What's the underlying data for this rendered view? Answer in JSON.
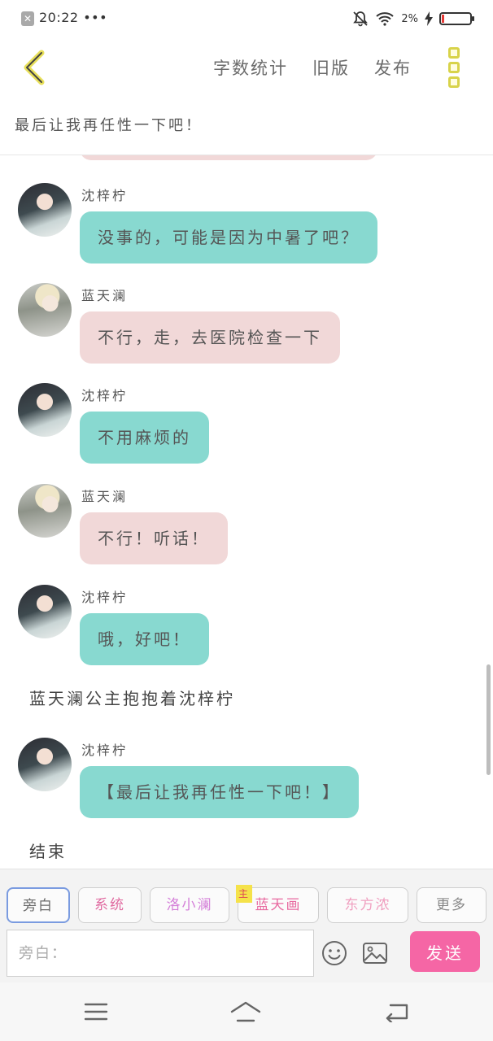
{
  "status_bar": {
    "time": "20:22",
    "dots": "•••",
    "battery_text": "2%",
    "battery_level": 0.02
  },
  "header": {
    "menu": [
      "字数统计",
      "旧版",
      "发布"
    ],
    "subtitle": "最后让我再任性一下吧！"
  },
  "messages": [
    {
      "sender": "沈梓柠",
      "avatar": "girl",
      "style": "teal",
      "text": "没事的，可能是因为中暑了吧？"
    },
    {
      "sender": "蓝天澜",
      "avatar": "boy",
      "style": "pink",
      "text": "不行，走，去医院检查一下"
    },
    {
      "sender": "沈梓柠",
      "avatar": "girl",
      "style": "teal",
      "text": "不用麻烦的"
    },
    {
      "sender": "蓝天澜",
      "avatar": "boy",
      "style": "pink",
      "text": "不行！听话！"
    },
    {
      "sender": "沈梓柠",
      "avatar": "girl",
      "style": "teal",
      "text": "哦，好吧！"
    }
  ],
  "narration": "蓝天澜公主抱抱着沈梓柠",
  "last_message": {
    "sender": "沈梓柠",
    "avatar": "girl",
    "style": "teal",
    "text": "【最后让我再任性一下吧！】"
  },
  "ending": "结束",
  "roles": [
    {
      "label": "旁白",
      "active": true
    },
    {
      "label": "系统",
      "color": "#e06aa0"
    },
    {
      "label": "洛小澜",
      "color": "#d47fd8"
    },
    {
      "label": "蓝天画",
      "color": "#e86aa0",
      "tag": "主"
    },
    {
      "label": "东方浓",
      "color": "#f0a0c0"
    },
    {
      "label": "更多",
      "color": "#888888"
    }
  ],
  "input": {
    "placeholder": "旁白："
  },
  "send_label": "发送",
  "colors": {
    "teal_bubble": "#88d9d0",
    "pink_bubble": "#f1d8d8",
    "send": "#f566a5",
    "accent": "#d8d34a"
  }
}
